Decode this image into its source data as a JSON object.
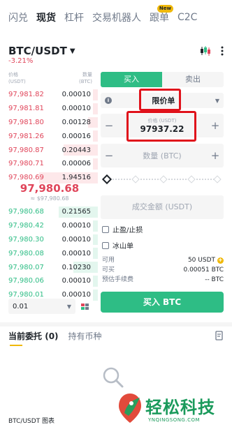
{
  "top_tabs": [
    {
      "label": "闪兑",
      "active": false
    },
    {
      "label": "现货",
      "active": true
    },
    {
      "label": "杠杆",
      "active": false
    },
    {
      "label": "交易机器人",
      "active": false
    },
    {
      "label": "跟单",
      "active": false,
      "badge": "New"
    },
    {
      "label": "C2C",
      "active": false
    }
  ],
  "pair": {
    "name": "BTC/USDT",
    "change": "-3.21%"
  },
  "icons": {
    "kline": "candlestick-icon",
    "more": "more-dots-icon",
    "info": "info-icon",
    "doc": "document-icon",
    "empty": "search-empty-icon"
  },
  "orderbook": {
    "price_header": "价格\n(USDT)",
    "qty_header": "数量\n(BTC)",
    "asks": [
      {
        "price": "97,981.82",
        "qty": "0.00010",
        "depth": 0.05
      },
      {
        "price": "97,981.81",
        "qty": "0.00010",
        "depth": 0.05
      },
      {
        "price": "97,981.80",
        "qty": "0.00128",
        "depth": 0.1
      },
      {
        "price": "97,981.26",
        "qty": "0.00016",
        "depth": 0.05
      },
      {
        "price": "97,980.87",
        "qty": "0.20443",
        "depth": 0.35
      },
      {
        "price": "97,980.71",
        "qty": "0.00006",
        "depth": 0.05
      },
      {
        "price": "97,980.69",
        "qty": "1.94516",
        "depth": 0.6
      }
    ],
    "mid_price": "97,980.68",
    "mid_sub": "≈ $97,980.68",
    "bids": [
      {
        "price": "97,980.68",
        "qty": "0.21565",
        "depth": 0.4
      },
      {
        "price": "97,980.42",
        "qty": "0.00010",
        "depth": 0.05
      },
      {
        "price": "97,980.30",
        "qty": "0.00010",
        "depth": 0.05
      },
      {
        "price": "97,980.08",
        "qty": "0.00010",
        "depth": 0.05
      },
      {
        "price": "97,980.07",
        "qty": "0.10230",
        "depth": 0.25
      },
      {
        "price": "97,980.06",
        "qty": "0.00010",
        "depth": 0.05
      },
      {
        "price": "97,980.01",
        "qty": "0.00010",
        "depth": 0.05
      }
    ],
    "precision": "0.01"
  },
  "order_form": {
    "buy_tab": "买入",
    "sell_tab": "卖出",
    "order_type": "限价单",
    "price_title": "价格 (USDT)",
    "price_value": "97937.22",
    "amount_placeholder": "数量 (BTC)",
    "total_placeholder": "成交金额 (USDT)",
    "tpsl": "止盈/止损",
    "iceberg": "冰山单",
    "available_label": "可用",
    "available_value": "50 USDT",
    "max_buy_label": "可买",
    "max_buy_value": "0.00051 BTC",
    "fee_label": "预估手续费",
    "fee_value": "-- BTC",
    "submit": "买入 BTC",
    "slider_percent": 0
  },
  "orders": {
    "tab_open": "当前委托",
    "tab_open_count": "(0)",
    "tab_holdings": "持有币种"
  },
  "bottom": {
    "label": "BTC/USDT 图表"
  },
  "watermark": {
    "title": "轻松科技",
    "url": "YNQINGSONG.COM"
  },
  "colors": {
    "buy": "#2ebd85",
    "sell": "#e0455a",
    "accent": "#f0b90b",
    "highlight": "#e0121b"
  }
}
